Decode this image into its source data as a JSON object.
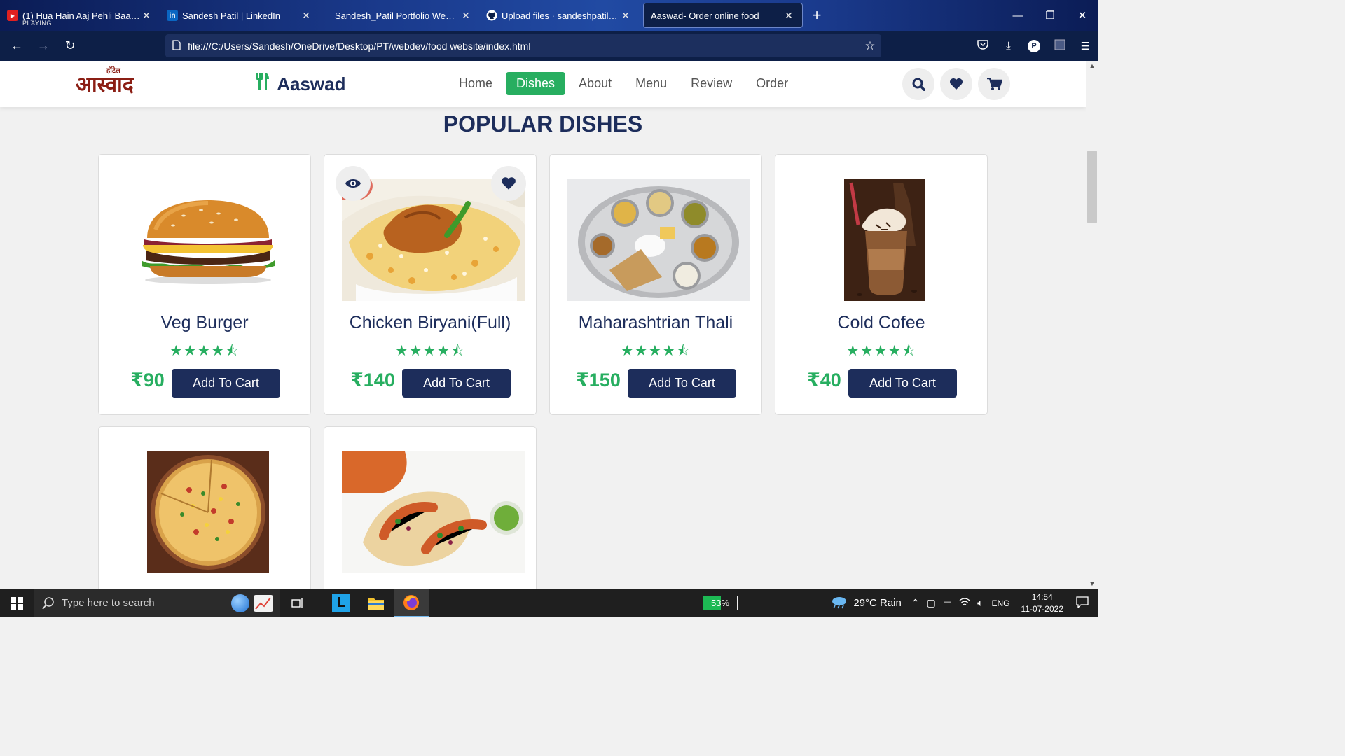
{
  "browser": {
    "tabs": [
      {
        "title": "(1) Hua Hain Aaj Pehli Baar FULL",
        "sub": "PLAYING",
        "icon": "youtube-icon"
      },
      {
        "title": "Sandesh Patil | LinkedIn",
        "icon": "linkedin-icon"
      },
      {
        "title": "Sandesh_Patil Portfolio Website",
        "icon": ""
      },
      {
        "title": "Upload files · sandeshpatil45/Fo",
        "icon": "github-icon"
      },
      {
        "title": "Aaswad- Order online food",
        "icon": ""
      }
    ],
    "url": "file:///C:/Users/Sandesh/OneDrive/Desktop/PT/webdev/food website/index.html",
    "profile_letter": "P"
  },
  "site": {
    "logo_text": "आस्वाद",
    "logo_small": "हॉटेल",
    "brand": "Aaswad",
    "menu": [
      "Home",
      "Dishes",
      "About",
      "Menu",
      "Review",
      "Order"
    ],
    "active_menu": "Dishes",
    "section_title": "POPULAR DISHES",
    "cart_label": "Add To Cart",
    "stars": "★★★★⯪",
    "rating": 4.5,
    "dishes": [
      {
        "name": "Veg Burger",
        "price": "₹90"
      },
      {
        "name": "Chicken Biryani(Full)",
        "price": "₹140"
      },
      {
        "name": "Maharashtrian Thali",
        "price": "₹150"
      },
      {
        "name": "Cold Cofee",
        "price": "₹40"
      },
      {
        "name": "",
        "price": ""
      },
      {
        "name": "",
        "price": ""
      }
    ]
  },
  "taskbar": {
    "search_placeholder": "Type here to search",
    "battery": "53%",
    "battery_level": 0.53,
    "weather": "29°C  Rain",
    "lang": "ENG",
    "time": "14:54",
    "date": "11-07-2022"
  },
  "colors": {
    "navy": "#1d2d5b",
    "green": "#27ae60",
    "logo_red": "#8b1e14"
  }
}
